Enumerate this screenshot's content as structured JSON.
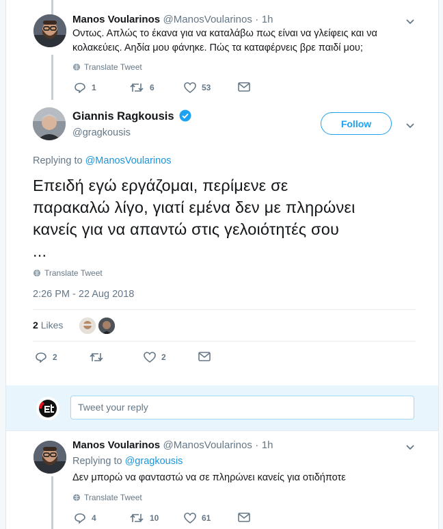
{
  "tweet1": {
    "name": "Manos Voularinos",
    "handle": "@ManosVoularinos",
    "dot": "·",
    "time": "1h",
    "text_line1": "Οντως. Απλώς το έκανα για να καταλάβω πως είναι να γλείφεις και να",
    "text_line2": "κολακεύεις. Αηδία μου φάνηκε. Πώς τα καταφέρνεις βρε παιδί μου;",
    "translate": "Translate Tweet",
    "replies": "1",
    "retweets": "6",
    "likes": "53"
  },
  "main_tweet": {
    "name": "Giannis Ragkousis",
    "handle": "@gragkousis",
    "follow_label": "Follow",
    "replying_prefix": "Replying to",
    "replying_to": "@ManosVoularinos",
    "text_line1": "Επειδή εγώ εργάζομαι, περίμενε σε",
    "text_line2": "παρακαλώ λίγο, γιατί εμένα δεν με πληρώνει",
    "text_line3": "κανείς για να απαντώ στις γελοιότητές σου",
    "text_line4": "...",
    "translate": "Translate Tweet",
    "timestamp": "2:26 PM - 22 Aug 2018",
    "likes_count": "2",
    "likes_label": "Likes",
    "replies": "2",
    "retweets": "",
    "likes": "2"
  },
  "reply_box": {
    "placeholder": "Tweet your reply"
  },
  "tweet3": {
    "name": "Manos Voularinos",
    "handle": "@ManosVoularinos",
    "dot": "·",
    "time": "1h",
    "replying_prefix": "Replying to",
    "replying_to": "@gragkousis",
    "text": "Δεν μπορώ να φανταστώ να σε πληρώνει κανείς για οτιδήποτε",
    "translate": "Translate Tweet",
    "replies": "4",
    "retweets": "10",
    "likes": "61"
  },
  "colors": {
    "brand": "#1da1f2",
    "link": "#1b95e0",
    "muted": "#657786",
    "verified": "#1da1f2"
  }
}
